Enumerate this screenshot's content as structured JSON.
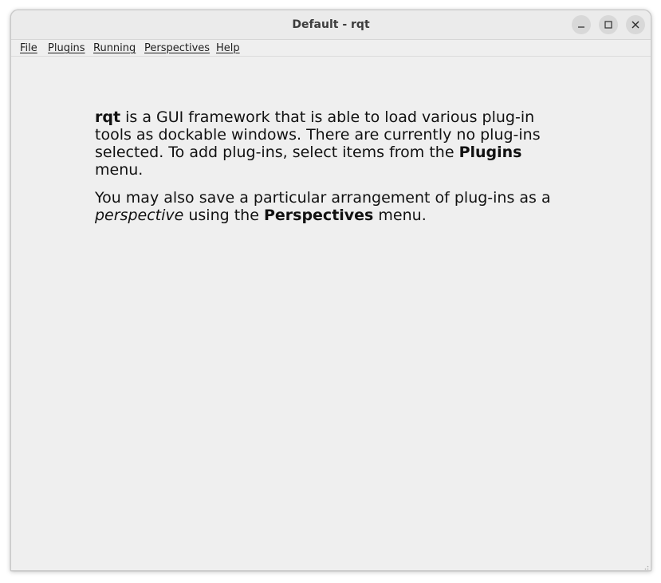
{
  "window": {
    "title": "Default - rqt"
  },
  "menubar": {
    "items": [
      {
        "label": "File"
      },
      {
        "label": "Plugins"
      },
      {
        "label": "Running"
      },
      {
        "label": "Perspectives"
      },
      {
        "label": "Help"
      }
    ]
  },
  "intro": {
    "p1_bold_start": "rqt",
    "p1_text": " is a GUI framework that is able to load various plug-in tools as dockable windows. There are currently no plug-ins selected. To add plug-ins, select items from the ",
    "p1_bold_end": "Plugins",
    "p1_tail": " menu.",
    "p2_text": "You may also save a particular arrangement of plug-ins as a ",
    "p2_italic": "perspective",
    "p2_mid": " using the ",
    "p2_bold": "Perspectives",
    "p2_tail": " menu."
  },
  "icons": {
    "minimize": "minimize-icon",
    "maximize": "maximize-icon",
    "close": "close-icon",
    "resize": "resize-grip-icon"
  }
}
